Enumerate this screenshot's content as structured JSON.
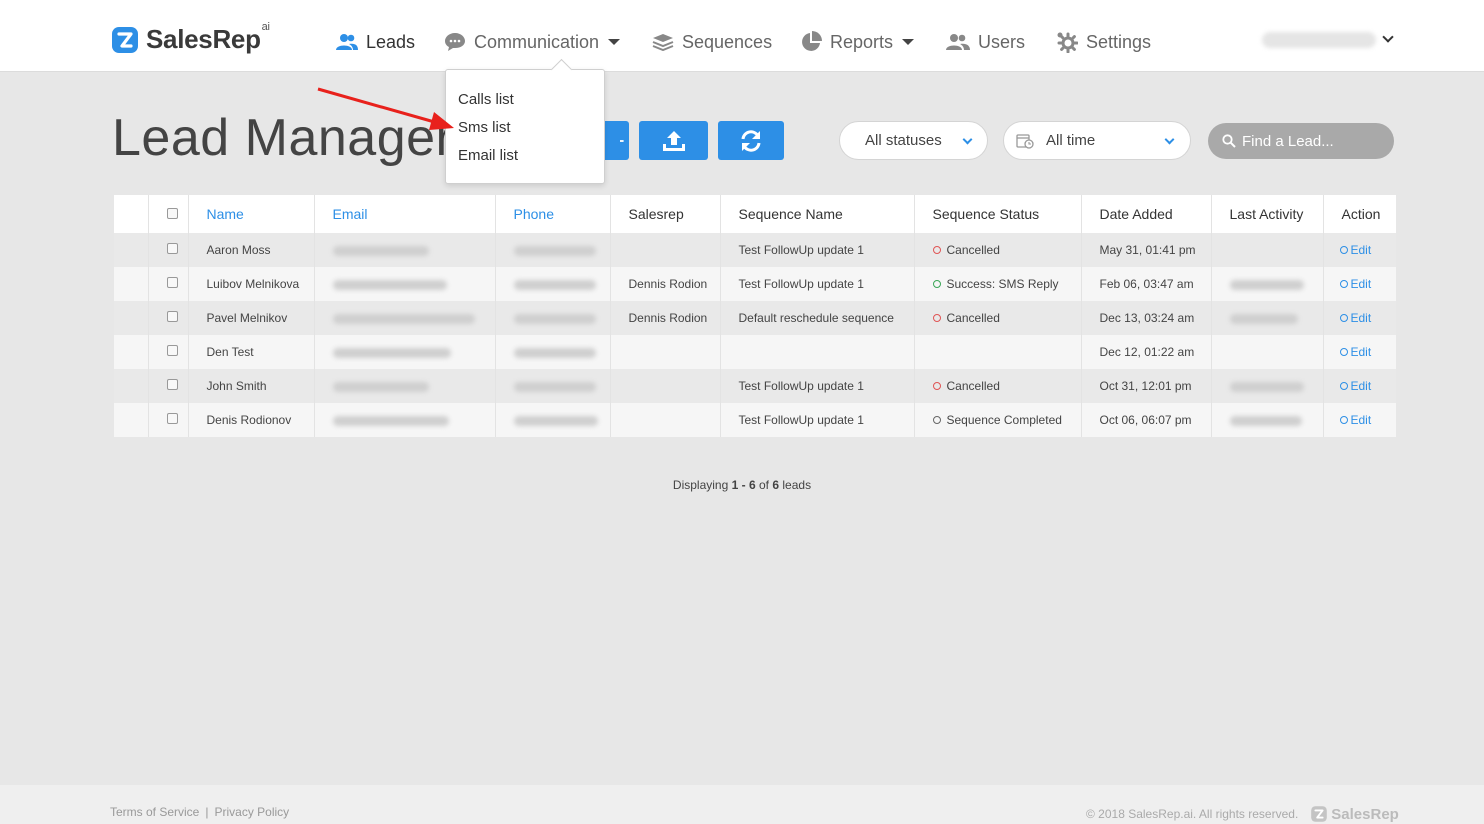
{
  "app": {
    "name": "SalesRep",
    "name_sup": "ai"
  },
  "nav": {
    "leads": "Leads",
    "communication": "Communication",
    "sequences": "Sequences",
    "reports": "Reports",
    "users": "Users",
    "settings": "Settings"
  },
  "dropdown": {
    "items": [
      "Calls list",
      "Sms list",
      "Email list"
    ]
  },
  "page": {
    "title": "Lead Manager"
  },
  "filters": {
    "status": "All statuses",
    "time": "All time",
    "search_placeholder": "Find a Lead..."
  },
  "table": {
    "headers": [
      "Name",
      "Email",
      "Phone",
      "Salesrep",
      "Sequence Name",
      "Sequence Status",
      "Date Added",
      "Last Activity",
      "Action"
    ],
    "rows": [
      {
        "name": "Aaron Moss",
        "salesrep": "",
        "sequence": "Test FollowUp update 1",
        "status": "Cancelled",
        "status_kind": "red",
        "date": "May 31, 01:41 pm",
        "action": "Edit"
      },
      {
        "name": "Luibov Melnikova",
        "salesrep": "Dennis Rodion",
        "sequence": "Test FollowUp update 1",
        "status": "Success: SMS Reply",
        "status_kind": "green",
        "date": "Feb 06, 03:47 am",
        "action": "Edit"
      },
      {
        "name": "Pavel Melnikov",
        "salesrep": "Dennis Rodion",
        "sequence": "Default reschedule sequence",
        "status": "Cancelled",
        "status_kind": "red",
        "date": "Dec 13, 03:24 am",
        "action": "Edit"
      },
      {
        "name": "Den Test",
        "salesrep": "",
        "sequence": "",
        "status": "",
        "status_kind": "",
        "date": "Dec 12, 01:22 am",
        "action": "Edit"
      },
      {
        "name": "John Smith",
        "salesrep": "",
        "sequence": "Test FollowUp update 1",
        "status": "Cancelled",
        "status_kind": "red",
        "date": "Oct 31, 12:01 pm",
        "action": "Edit"
      },
      {
        "name": "Denis Rodionov",
        "salesrep": "",
        "sequence": "Test FollowUp update 1",
        "status": "Sequence Completed",
        "status_kind": "gray",
        "date": "Oct 06, 06:07 pm",
        "action": "Edit"
      }
    ]
  },
  "pager": {
    "prefix": "Displaying",
    "range": "1 - 6",
    "of": "of",
    "total": "6",
    "suffix": "leads"
  },
  "footer": {
    "terms": "Terms of Service",
    "separator": "|",
    "privacy": "Privacy Policy",
    "copyright": "© 2018 SalesRep.ai. All rights reserved.",
    "logo_text": "SalesRep"
  },
  "colors": {
    "accent": "#2d8fe6",
    "cancel": "#e05555",
    "success": "#3aa657"
  }
}
